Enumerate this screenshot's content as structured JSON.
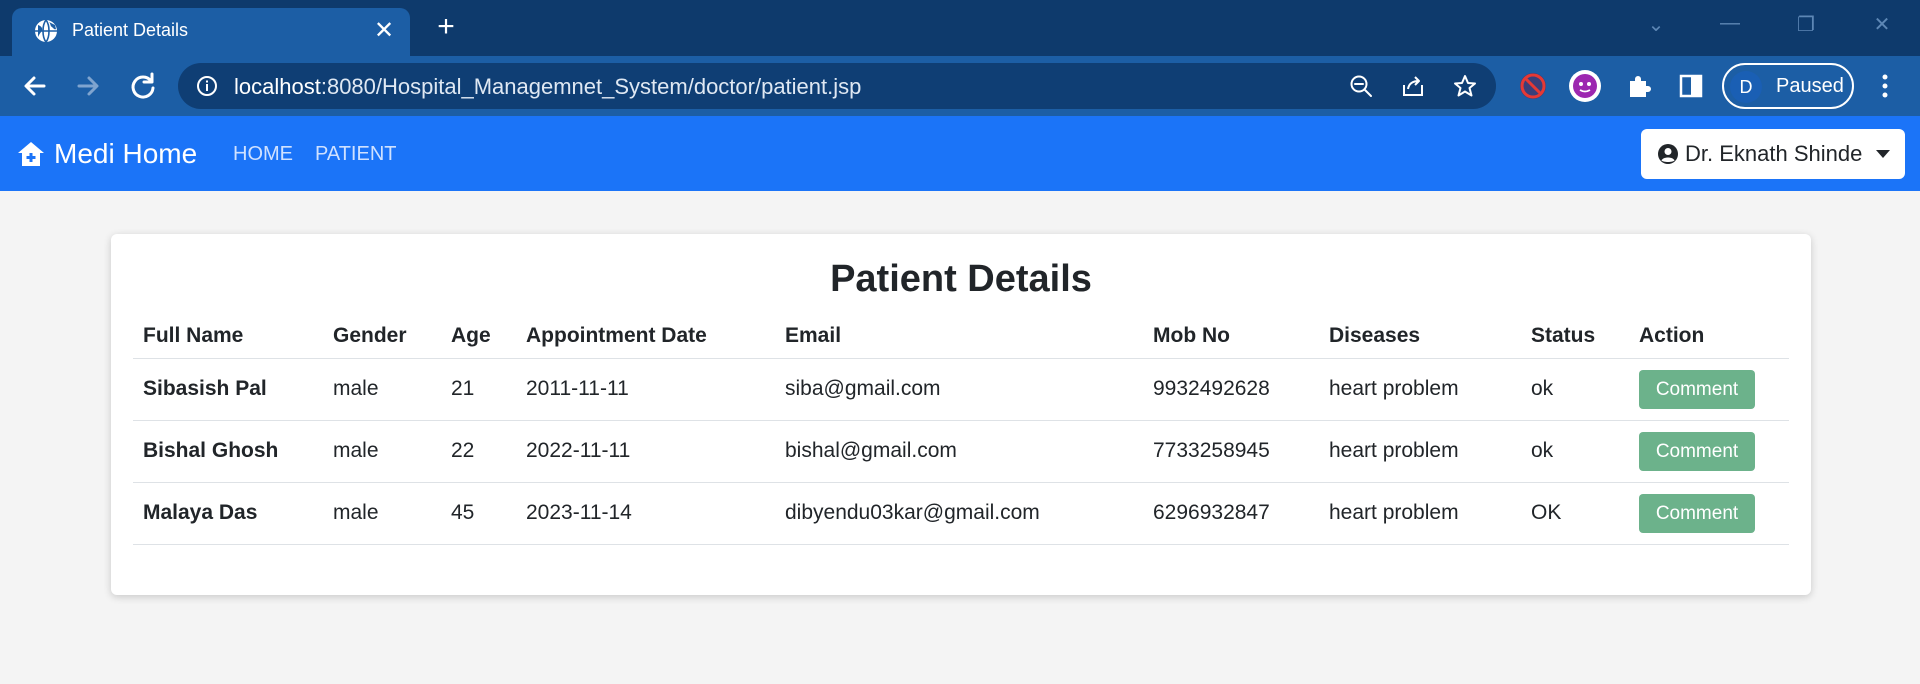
{
  "browser": {
    "tab_title": "Patient Details",
    "url_host": "localhost",
    "url_rest": ":8080/Hospital_Managemnet_System/doctor/patient.jsp",
    "profile_initial": "D",
    "profile_status": "Paused"
  },
  "app": {
    "brand": "Medi Home",
    "nav": [
      "HOME",
      "PATIENT"
    ],
    "user": "Dr. Eknath Shinde"
  },
  "card": {
    "title": "Patient Details",
    "columns": [
      "Full Name",
      "Gender",
      "Age",
      "Appointment Date",
      "Email",
      "Mob No",
      "Diseases",
      "Status",
      "Action"
    ],
    "rows": [
      {
        "name": "Sibasish Pal",
        "gender": "male",
        "age": "21",
        "date": "2011-11-11",
        "email": "siba@gmail.com",
        "mobile": "9932492628",
        "disease": "heart problem",
        "status": "ok",
        "action": "Comment"
      },
      {
        "name": "Bishal Ghosh",
        "gender": "male",
        "age": "22",
        "date": "2022-11-11",
        "email": "bishal@gmail.com",
        "mobile": "7733258945",
        "disease": "heart problem",
        "status": "ok",
        "action": "Comment"
      },
      {
        "name": "Malaya Das",
        "gender": "male",
        "age": "45",
        "date": "2023-11-14",
        "email": "dibyendu03kar@gmail.com",
        "mobile": "6296932847",
        "disease": "heart problem",
        "status": "OK",
        "action": "Comment"
      }
    ]
  },
  "colors": {
    "chrome_titlebar": "#0e3a6c",
    "chrome_toolbar": "#1c5ea5",
    "navbar": "#1b74f8",
    "comment_button": "#6cb28b"
  }
}
